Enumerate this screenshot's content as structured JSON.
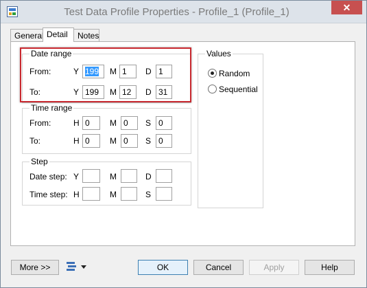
{
  "window": {
    "title": "Test Data Profile Properties - Profile_1 (Profile_1)",
    "close_glyph": "✕"
  },
  "tabs": [
    {
      "label": "General"
    },
    {
      "label": "Detail"
    },
    {
      "label": "Notes"
    }
  ],
  "date_range": {
    "title": "Date range",
    "from": {
      "label": "From:",
      "y_label": "Y",
      "y_value": "199",
      "m_label": "M",
      "m_value": "1",
      "d_label": "D",
      "d_value": "1"
    },
    "to": {
      "label": "To:",
      "y_label": "Y",
      "y_value": "199",
      "m_label": "M",
      "m_value": "12",
      "d_label": "D",
      "d_value": "31"
    }
  },
  "time_range": {
    "title": "Time range",
    "from": {
      "label": "From:",
      "h_label": "H",
      "h_value": "0",
      "m_label": "M",
      "m_value": "0",
      "s_label": "S",
      "s_value": "0"
    },
    "to": {
      "label": "To:",
      "h_label": "H",
      "h_value": "0",
      "m_label": "M",
      "m_value": "0",
      "s_label": "S",
      "s_value": "0"
    }
  },
  "step": {
    "title": "Step",
    "date_step": {
      "label": "Date step:",
      "y_label": "Y",
      "y_value": "",
      "m_label": "M",
      "m_value": "",
      "d_label": "D",
      "d_value": ""
    },
    "time_step": {
      "label": "Time step:",
      "h_label": "H",
      "h_value": "",
      "m_label": "M",
      "m_value": "",
      "s_label": "S",
      "s_value": ""
    }
  },
  "values": {
    "title": "Values",
    "options": [
      {
        "label": "Random",
        "selected": true
      },
      {
        "label": "Sequential",
        "selected": false
      }
    ]
  },
  "footer": {
    "more_label": "More >>",
    "ok_label": "OK",
    "cancel_label": "Cancel",
    "apply_label": "Apply",
    "help_label": "Help"
  },
  "icons": {
    "app": "profile-window-icon",
    "toolbar": "property-list-icon",
    "dropdown": "dropdown-arrow-icon"
  },
  "colors": {
    "highlight": "#c8282f",
    "selection": "#3399ff",
    "close_button": "#c75050"
  }
}
